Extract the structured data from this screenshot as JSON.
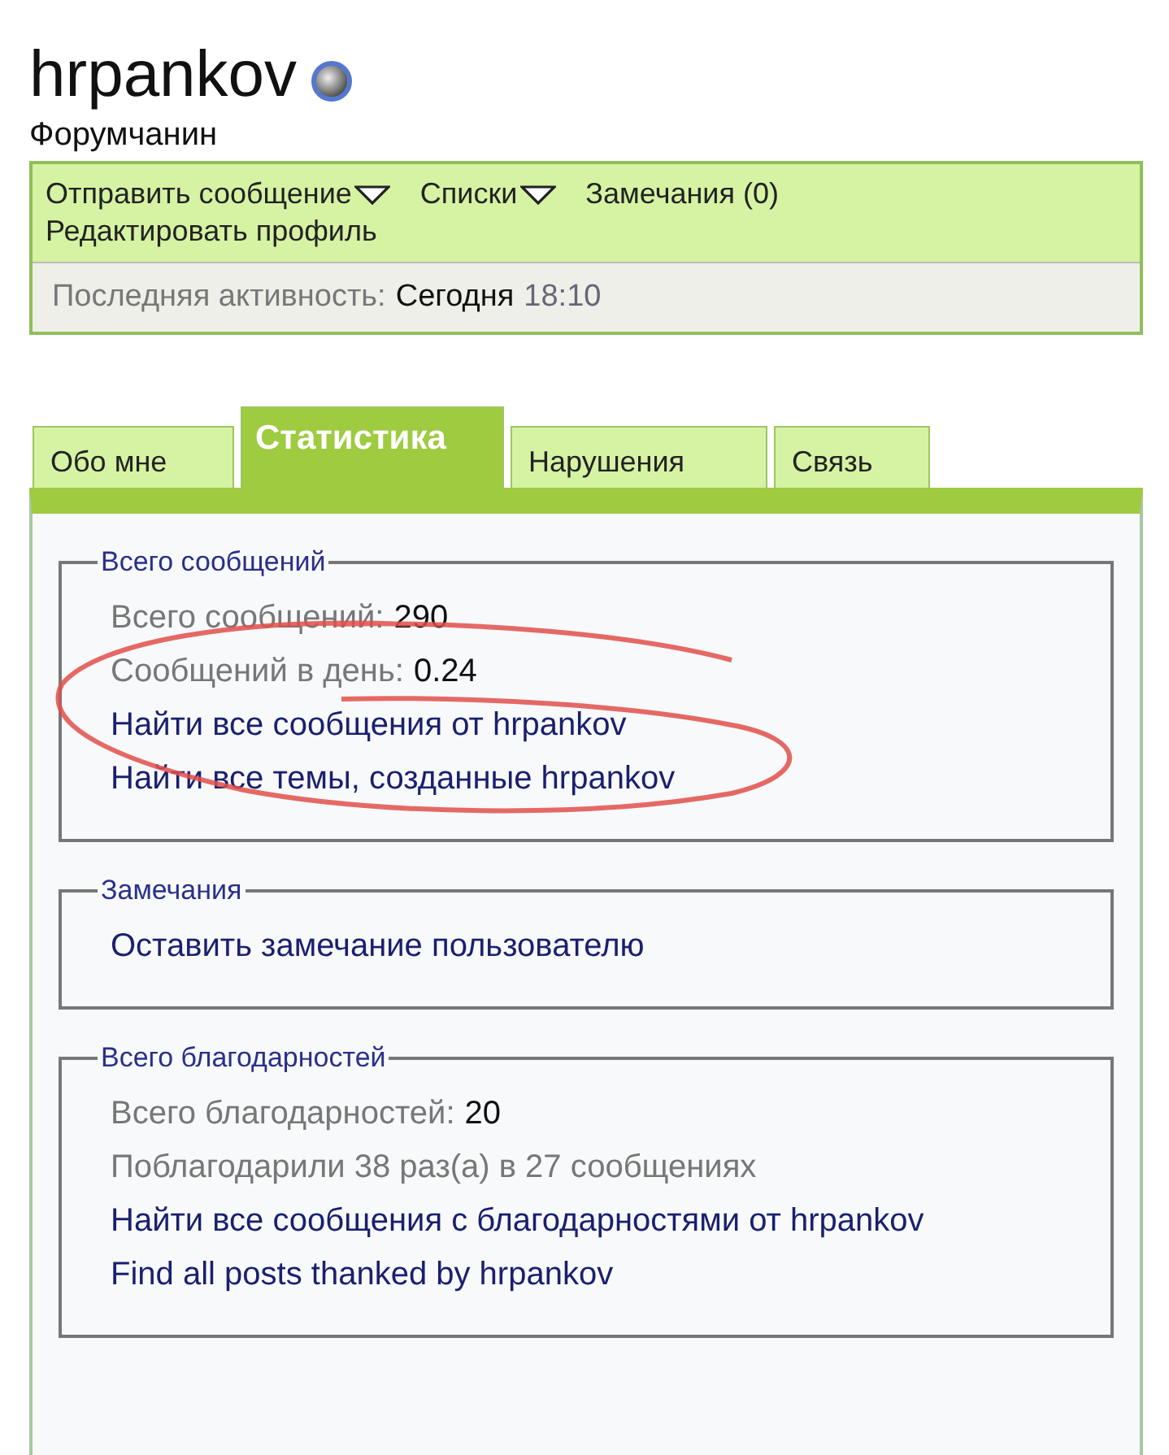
{
  "profile": {
    "username": "hrpankov",
    "rank": "Форумчанин"
  },
  "actions": [
    {
      "label": "Отправить сообщение",
      "dropdown": true
    },
    {
      "label": "Списки",
      "dropdown": true
    },
    {
      "label": "Замечания (0)",
      "dropdown": false
    },
    {
      "label": "Редактировать профиль",
      "dropdown": false
    }
  ],
  "last_activity": {
    "label": "Последняя активность:",
    "day": "Сегодня",
    "time": "18:10"
  },
  "tabs": [
    {
      "label": "Обо мне",
      "selected": false
    },
    {
      "label": "Статистика",
      "selected": true
    },
    {
      "label": "Нарушения",
      "selected": false
    },
    {
      "label": "Связь",
      "selected": false
    }
  ],
  "sections": [
    {
      "title": "Всего сообщений",
      "lines": [
        {
          "kind": "stat",
          "label": "Всего сообщений:",
          "value": "290"
        },
        {
          "kind": "stat",
          "label": "Сообщений в день:",
          "value": "0.24"
        },
        {
          "kind": "link",
          "text": "Найти все сообщения от hrpankov"
        },
        {
          "kind": "link",
          "text": "Найти все темы, созданные hrpankov"
        }
      ]
    },
    {
      "title": "Замечания",
      "lines": [
        {
          "kind": "link",
          "text": "Оставить замечание пользователю"
        }
      ]
    },
    {
      "title": "Всего благодарностей",
      "lines": [
        {
          "kind": "stat",
          "label": "Всего благодарностей:",
          "value": "20"
        },
        {
          "kind": "stat",
          "label": "Поблагодарили 38 раз(а) в 27 сообщениях"
        },
        {
          "kind": "link",
          "text": "Найти все сообщения с благодарностями от hrpankov"
        },
        {
          "kind": "link",
          "text": "Find all posts thanked by hrpankov"
        }
      ]
    }
  ]
}
